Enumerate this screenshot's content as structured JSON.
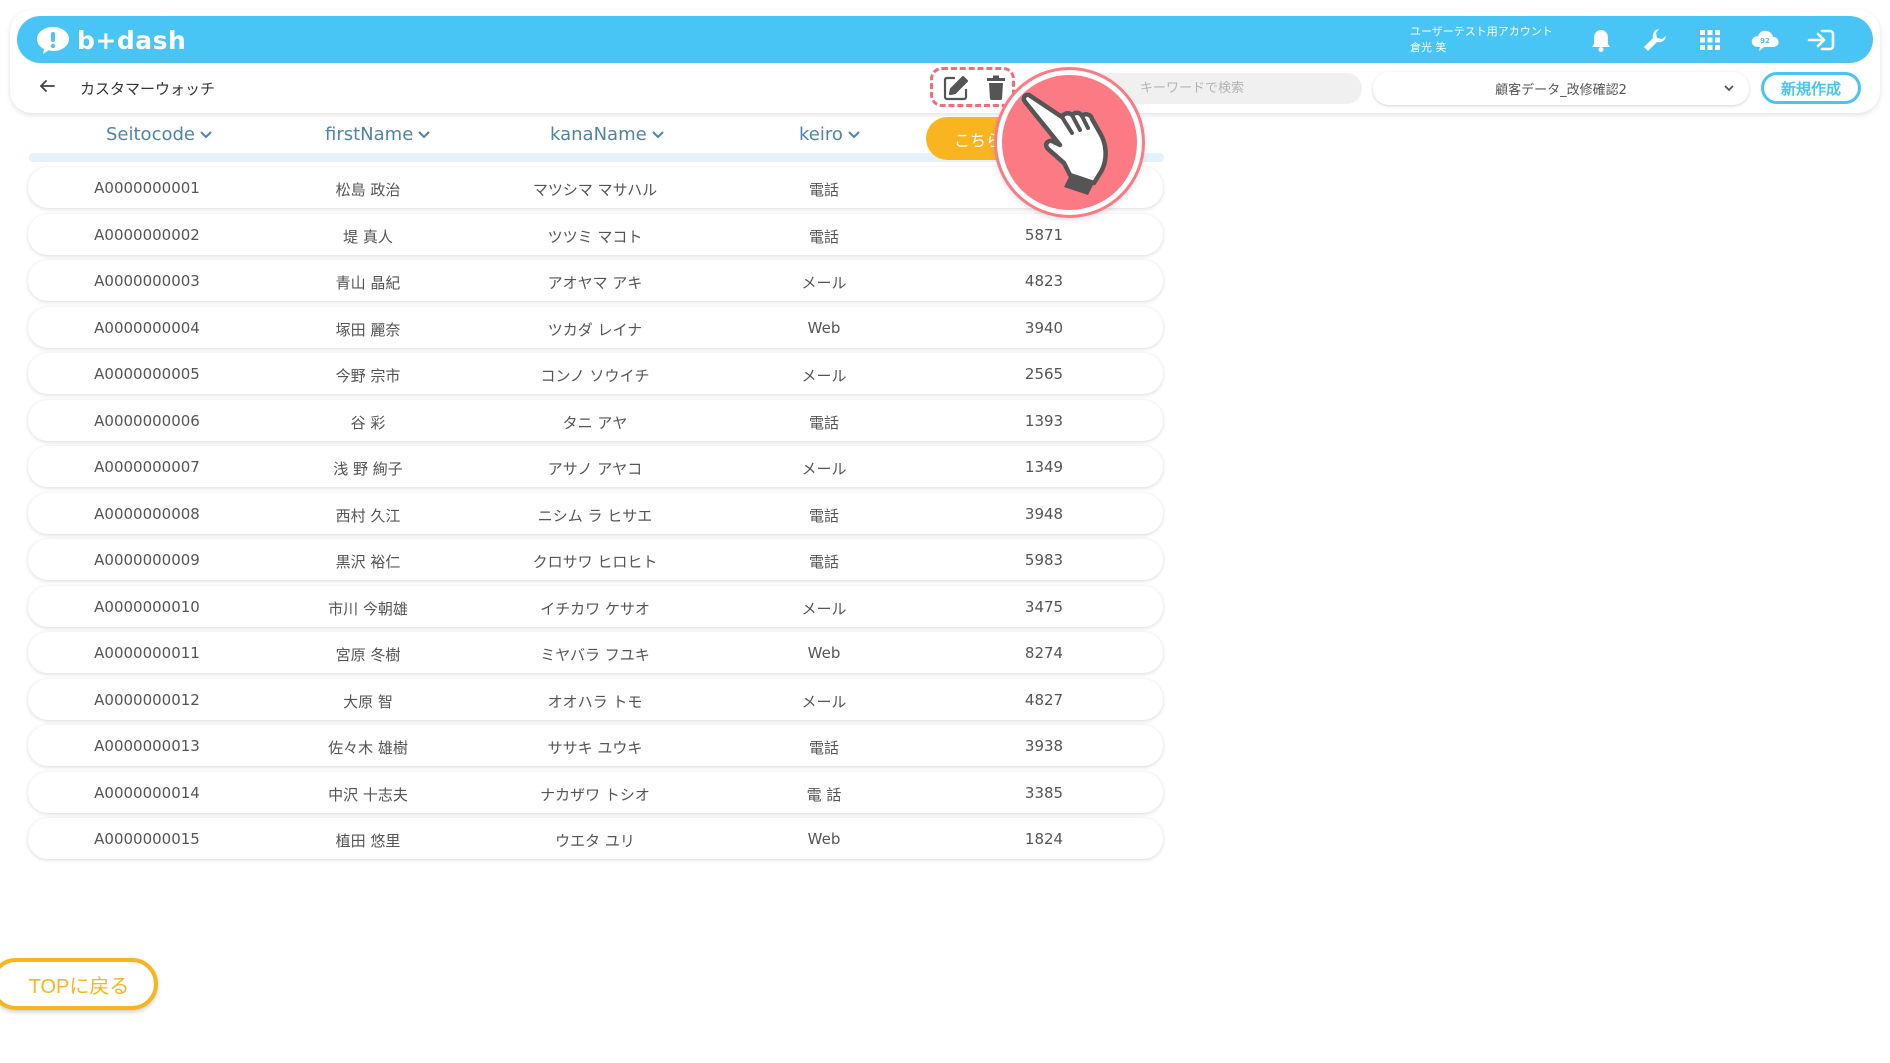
{
  "header": {
    "logo_text": "b+dash",
    "account_name": "ユーザーテスト用アカウント",
    "user_name": "倉光 笑"
  },
  "subheader": {
    "title": "カスタマーウォッチ",
    "search_placeholder": "キーワードで検索",
    "dataset_selected": "顧客データ_改修確認2",
    "new_button": "新規作成"
  },
  "table": {
    "columns": [
      "Seitocode",
      "firstName",
      "kanaName",
      "keiro"
    ],
    "action_button": "こちら",
    "rows": [
      {
        "code": "A0000000001",
        "name": "松島 政治",
        "kana": "マツシマ マサハル",
        "keiro": "電話",
        "value": ""
      },
      {
        "code": "A0000000002",
        "name": "堤 真人",
        "kana": "ツツミ マコト",
        "keiro": "電話",
        "value": "5871"
      },
      {
        "code": "A0000000003",
        "name": "青山 晶紀",
        "kana": "アオヤマ アキ",
        "keiro": "メール",
        "value": "4823"
      },
      {
        "code": "A0000000004",
        "name": "塚田 麗奈",
        "kana": "ツカダ レイナ",
        "keiro": "Web",
        "value": "3940"
      },
      {
        "code": "A0000000005",
        "name": "今野 宗市",
        "kana": "コンノ ソウイチ",
        "keiro": "メール",
        "value": "2565"
      },
      {
        "code": "A0000000006",
        "name": "谷 彩",
        "kana": "タニ アヤ",
        "keiro": "電話",
        "value": "1393"
      },
      {
        "code": "A0000000007",
        "name": "浅 野 絢子",
        "kana": "アサノ アヤコ",
        "keiro": "メール",
        "value": "1349"
      },
      {
        "code": "A0000000008",
        "name": "西村 久江",
        "kana": "ニシム ラ ヒサエ",
        "keiro": "電話",
        "value": "3948"
      },
      {
        "code": "A0000000009",
        "name": "黒沢 裕仁",
        "kana": "クロサワ ヒロヒト",
        "keiro": "電話",
        "value": "5983"
      },
      {
        "code": "A0000000010",
        "name": "市川 今朝雄",
        "kana": "イチカワ ケサオ",
        "keiro": "メール",
        "value": "3475"
      },
      {
        "code": "A0000000011",
        "name": "宮原 冬樹",
        "kana": "ミヤバラ フユキ",
        "keiro": "Web",
        "value": "8274"
      },
      {
        "code": "A0000000012",
        "name": "大原 智",
        "kana": "オオハラ トモ",
        "keiro": "メール",
        "value": "4827"
      },
      {
        "code": "A0000000013",
        "name": "佐々木 雄樹",
        "kana": "ササキ ユウキ",
        "keiro": "電話",
        "value": "3938"
      },
      {
        "code": "A0000000014",
        "name": "中沢 十志夫",
        "kana": "ナカザワ トシオ",
        "keiro": "電 話",
        "value": "3385"
      },
      {
        "code": "A0000000015",
        "name": "植田 悠里",
        "kana": "ウエタ ユリ",
        "keiro": "Web",
        "value": "1824"
      }
    ]
  },
  "footer": {
    "top_button": "TOPに戻る"
  },
  "colors": {
    "brand_blue": "#48c5f5",
    "accent_orange": "#f8b51f",
    "highlight_pink": "#f36b7c"
  },
  "icons": [
    "bell-icon",
    "wrench-icon",
    "grid-icon",
    "cloud-chat-icon",
    "logout-icon",
    "edit-icon",
    "trash-icon",
    "pointer-hand-icon"
  ]
}
